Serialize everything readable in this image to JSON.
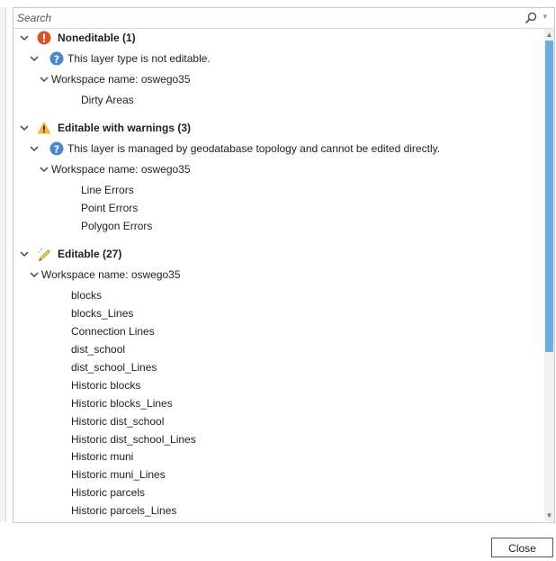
{
  "search": {
    "placeholder": "Search"
  },
  "groups": {
    "noneditable": {
      "label": "Noneditable (1)",
      "reason": "This layer type is not editable.",
      "workspace": "Workspace name: oswego35",
      "layers": [
        "Dirty Areas"
      ]
    },
    "warnings": {
      "label": "Editable with warnings (3)",
      "reason": "This layer is managed by geodatabase topology and cannot be edited directly.",
      "workspace": "Workspace name: oswego35",
      "layers": [
        "Line Errors",
        "Point Errors",
        "Polygon Errors"
      ]
    },
    "editable": {
      "label": "Editable (27)",
      "workspace": "Workspace name: oswego35",
      "layers": [
        "blocks",
        "blocks_Lines",
        "Connection Lines",
        "dist_school",
        "dist_school_Lines",
        "Historic blocks",
        "Historic blocks_Lines",
        "Historic dist_school",
        "Historic dist_school_Lines",
        "Historic muni",
        "Historic muni_Lines",
        "Historic parcels",
        "Historic parcels_Lines"
      ]
    }
  },
  "footer": {
    "close_label": "Close"
  },
  "colors": {
    "accent": "#6aaee0",
    "error": "#d9542b",
    "warning": "#f5b53c",
    "info": "#4a86c8"
  },
  "icons": [
    "error-icon",
    "info-icon",
    "warning-icon",
    "pencil-icon",
    "search-icon",
    "chevron-down-icon"
  ]
}
